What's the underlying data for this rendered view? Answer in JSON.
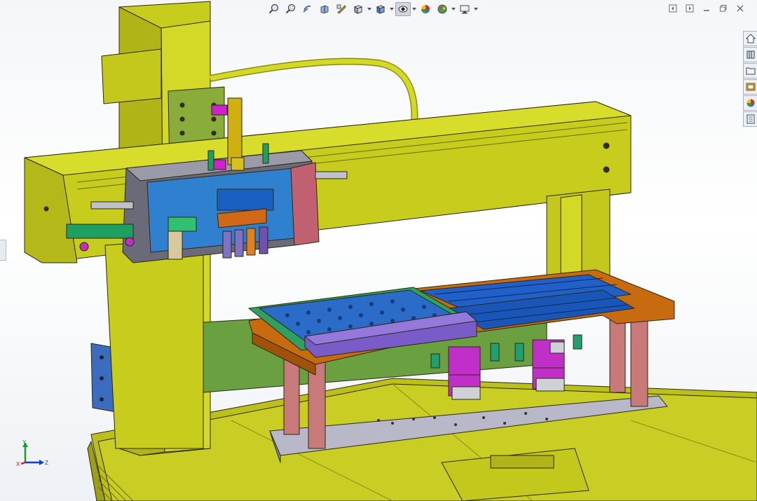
{
  "app": "SolidWorks",
  "viewport": {
    "scene": "gantry-dispensing-machine-assembly"
  },
  "heads_up_toolbar": {
    "buttons": [
      {
        "icon": "zoom-to-fit-icon"
      },
      {
        "icon": "zoom-to-area-icon"
      },
      {
        "icon": "previous-view-icon"
      },
      {
        "icon": "section-view-icon"
      },
      {
        "icon": "dynamic-annotation-views-icon"
      },
      {
        "icon": "view-orientation-icon",
        "dropdown": true
      },
      {
        "icon": "display-style-icon",
        "dropdown": true
      },
      {
        "icon": "hide-show-items-icon",
        "dropdown": true,
        "active": true
      },
      {
        "icon": "edit-appearance-icon"
      },
      {
        "icon": "apply-scene-icon",
        "dropdown": true
      },
      {
        "icon": "view-settings-icon",
        "dropdown": true
      }
    ]
  },
  "window_controls": [
    "restore-left-icon",
    "restore-right-icon",
    "minimize-icon",
    "maximize-icon",
    "close-icon"
  ],
  "task_pane_tabs": [
    {
      "icon": "home-icon"
    },
    {
      "icon": "design-library-icon"
    },
    {
      "icon": "file-explorer-icon"
    },
    {
      "icon": "view-palette-icon"
    },
    {
      "icon": "appearances-icon"
    },
    {
      "icon": "custom-properties-icon"
    }
  ],
  "triad": {
    "x_label": "X",
    "y_label": "Y",
    "z_label": "Z"
  },
  "colors": {
    "frame_yellow": "#c8cc1c",
    "plate_orange": "#c86a10",
    "tray_blue": "#2060c8",
    "fixture_purple": "#7a5cc8",
    "post_pink": "#c07878",
    "background": "#f4f6f8"
  }
}
